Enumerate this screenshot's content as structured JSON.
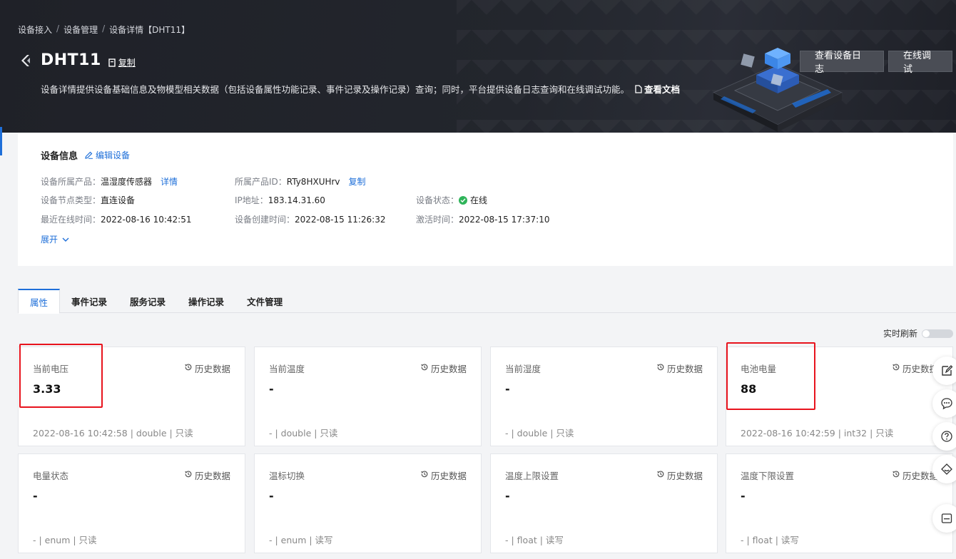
{
  "breadcrumb": [
    "设备接入",
    "设备管理",
    "设备详情【DHT11】"
  ],
  "header": {
    "title": "DHT11",
    "copy_label": "复制",
    "description": "设备详情提供设备基础信息及物模型相关数据（包括设备属性功能记录、事件记录及操作记录）查询；同时，平台提供设备日志查询和在线调试功能。",
    "doc_link": "查看文档",
    "btn_log": "查看设备日志",
    "btn_debug": "在线调试"
  },
  "device_info": {
    "title": "设备信息",
    "edit_label": "编辑设备",
    "product": {
      "label": "设备所属产品：",
      "value": "温湿度传感器",
      "link": "详情"
    },
    "product_id": {
      "label": "所属产品ID：",
      "value": "RTy8HXUHrv",
      "link": "复制"
    },
    "node_type": {
      "label": "设备节点类型：",
      "value": "直连设备"
    },
    "ip": {
      "label": "IP地址：",
      "value": "183.14.31.60"
    },
    "status": {
      "label": "设备状态：",
      "value": "在线"
    },
    "last_online": {
      "label": "最近在线时间：",
      "value": "2022-08-16 10:42:51"
    },
    "created": {
      "label": "设备创建时间：",
      "value": "2022-08-15 11:26:32"
    },
    "activated": {
      "label": "激活时间：",
      "value": "2022-08-15 17:37:10"
    },
    "expand_label": "展开"
  },
  "tabs": [
    "属性",
    "事件记录",
    "服务记录",
    "操作记录",
    "文件管理"
  ],
  "realtime": {
    "label": "实时刷新",
    "enabled": false
  },
  "history_label": "历史数据",
  "properties": [
    {
      "name": "当前电压",
      "value": "3.33",
      "meta": "2022-08-16 10:42:58 | double | 只读"
    },
    {
      "name": "当前温度",
      "value": "-",
      "meta": "- | double | 只读"
    },
    {
      "name": "当前湿度",
      "value": "-",
      "meta": "- | double | 只读"
    },
    {
      "name": "电池电量",
      "value": "88",
      "meta": "2022-08-16 10:42:59 | int32 | 只读"
    },
    {
      "name": "电量状态",
      "value": "-",
      "meta": "- | enum | 只读"
    },
    {
      "name": "温标切换",
      "value": "-",
      "meta": "- | enum | 读写"
    },
    {
      "name": "温度上限设置",
      "value": "-",
      "meta": "- | float | 读写"
    },
    {
      "name": "温度下限设置",
      "value": "-",
      "meta": "- | float | 读写"
    }
  ],
  "colors": {
    "accent": "#1e6fd9",
    "online": "#2fb45a",
    "highlight": "#e8131d"
  }
}
